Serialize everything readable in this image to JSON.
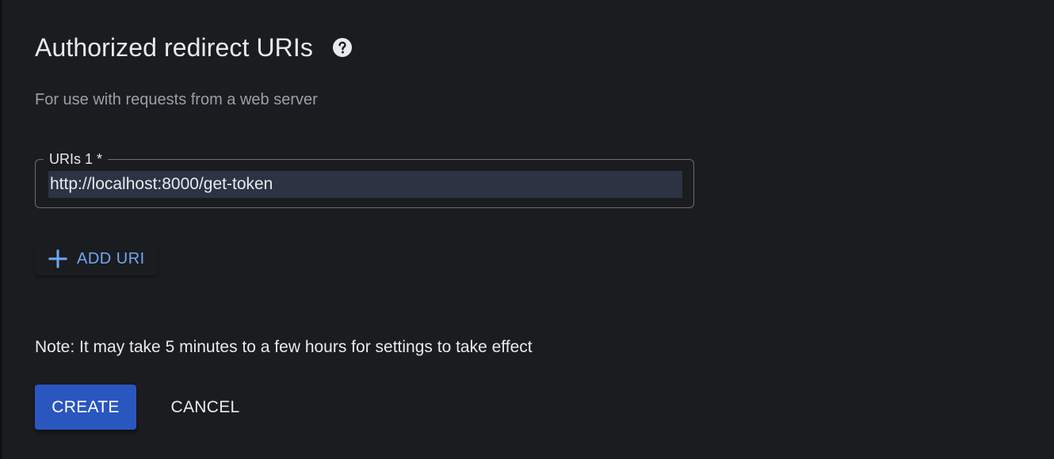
{
  "section": {
    "title": "Authorized redirect URIs",
    "help_icon": "help-circle-icon",
    "subtitle": "For use with requests from a web server"
  },
  "uri_field": {
    "label": "URIs 1 *",
    "value": "http://localhost:8000/get-token"
  },
  "add_uri": {
    "icon": "plus-icon",
    "label": "ADD URI"
  },
  "note": "Note: It may take 5 minutes to a few hours for settings to take effect",
  "actions": {
    "create_label": "CREATE",
    "cancel_label": "CANCEL"
  },
  "colors": {
    "background": "#1b1c1f",
    "accent_text": "#6ea8f7",
    "primary_button": "#2a56c0",
    "input_highlight": "#2c3443"
  }
}
